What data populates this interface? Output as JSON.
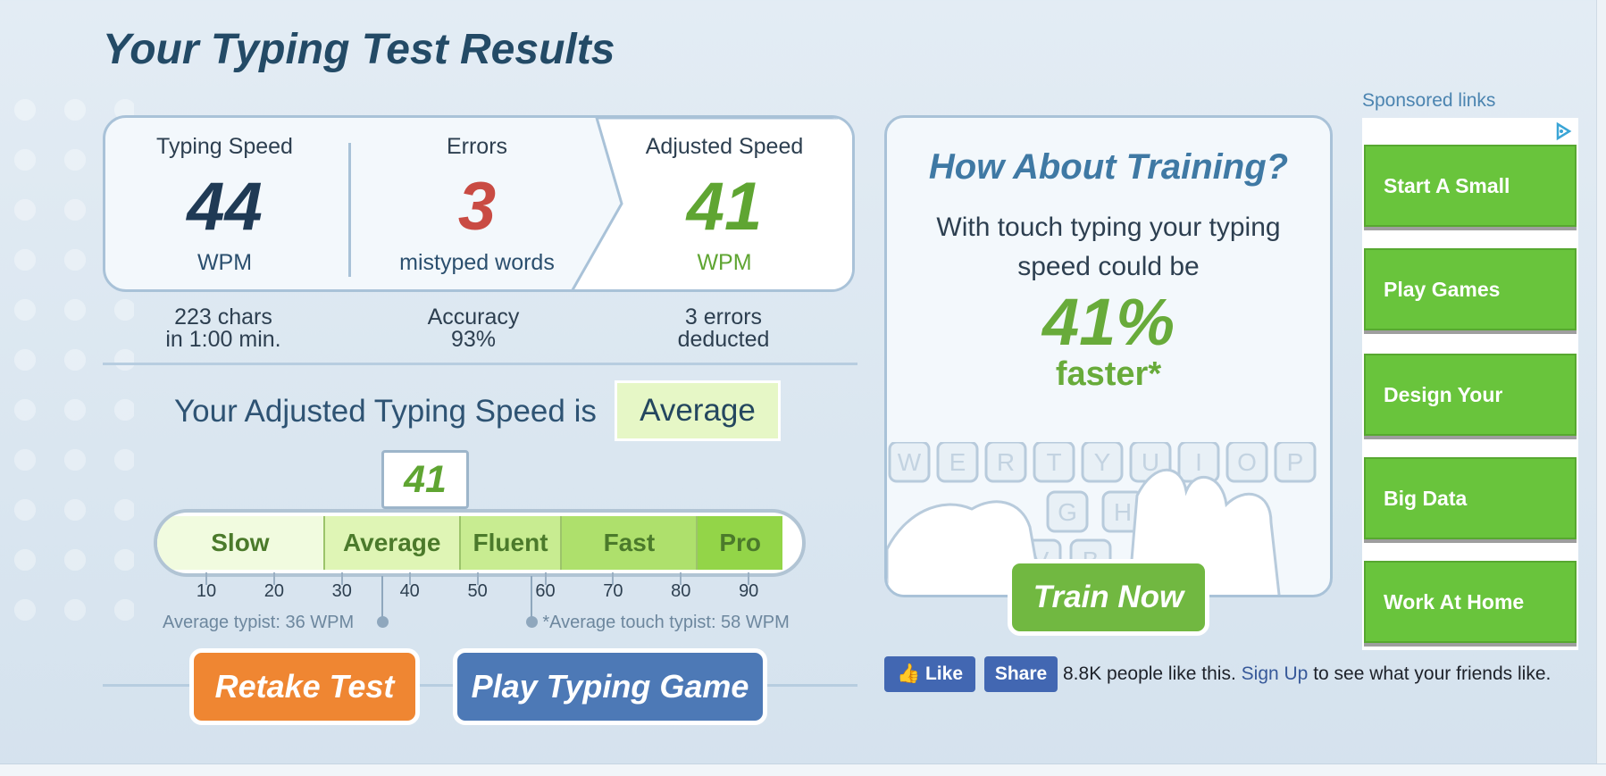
{
  "page_title": "Your Typing Test Results",
  "results": {
    "speed": {
      "header": "Typing Speed",
      "value": "44",
      "unit": "WPM"
    },
    "errors": {
      "header": "Errors",
      "value": "3",
      "unit": "mistyped words"
    },
    "adjusted": {
      "header": "Adjusted Speed",
      "value": "41",
      "unit": "WPM"
    },
    "sub_chars_l1": "223 chars",
    "sub_chars_l2": "in 1:00 min.",
    "sub_accuracy_l1": "Accuracy",
    "sub_accuracy_l2": "93%",
    "sub_deducted_l1": "3 errors",
    "sub_deducted_l2": "deducted"
  },
  "rating": {
    "label": "Your Adjusted Typing Speed is",
    "value": "Average",
    "marker": "41",
    "marker_value": 41
  },
  "scale": {
    "segments": [
      {
        "label": "Slow",
        "from": 0,
        "to": 27.5,
        "color": "#f1fbdf"
      },
      {
        "label": "Average",
        "from": 27.5,
        "to": 47.5,
        "color": "#dff5b5"
      },
      {
        "label": "Fluent",
        "from": 47.5,
        "to": 62.5,
        "color": "#c8ec91"
      },
      {
        "label": "Fast",
        "from": 62.5,
        "to": 82.5,
        "color": "#aee06c"
      },
      {
        "label": "Pro",
        "from": 82.5,
        "to": 95,
        "color": "#93d548"
      }
    ],
    "ticks": [
      "10",
      "20",
      "30",
      "40",
      "50",
      "60",
      "70",
      "80",
      "90"
    ],
    "avg_typist_label": "Average typist: 36 WPM",
    "avg_typist_value": 36,
    "avg_touch_label": "*Average touch typist: 58 WPM",
    "avg_touch_value": 58
  },
  "buttons": {
    "retake": "Retake Test",
    "play_game": "Play Typing Game",
    "train_now": "Train Now"
  },
  "training": {
    "title": "How About Training?",
    "line1": "With touch typing your typing",
    "line2": "speed could be",
    "percent": "41%",
    "faster": "faster*",
    "keys_row1": [
      "W",
      "E",
      "R",
      "T",
      "Y",
      "U",
      "I",
      "O",
      "P"
    ],
    "keys_row2": [
      "G",
      "H"
    ],
    "keys_row3": [
      "V",
      "B"
    ]
  },
  "facebook": {
    "like": "Like",
    "share": "Share",
    "text_before": "8.8K people like this.",
    "link": "Sign Up",
    "text_after": "to see what your friends like."
  },
  "ads": {
    "sponsored_label": "Sponsored links",
    "items": [
      "Start A Small",
      "Play Games",
      "Design Your",
      "Big Data",
      "Work At Home"
    ]
  },
  "colors": {
    "orange": "#ef8632",
    "blue": "#4d79b6",
    "green": "#71b841",
    "error_red": "#c94b43",
    "adjusted_green": "#5fa532"
  }
}
